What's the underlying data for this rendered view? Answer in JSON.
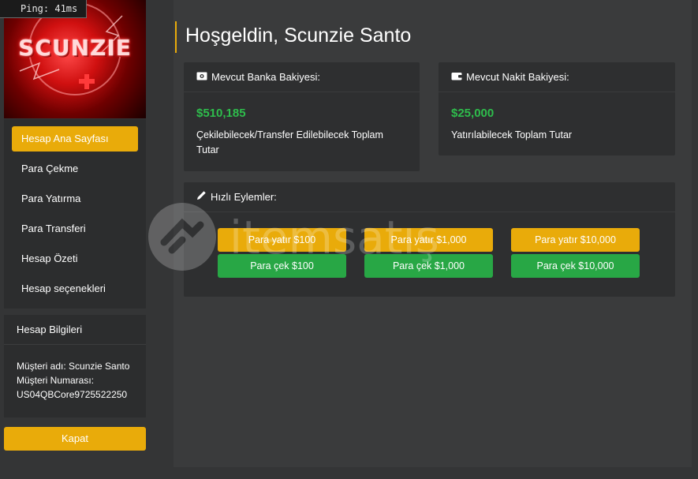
{
  "ping": "Ping: 41ms",
  "logo": {
    "text": "SCUNZIE"
  },
  "sidebar": {
    "items": [
      {
        "label": "Hesap Ana Sayfası",
        "active": true
      },
      {
        "label": "Para Çekme",
        "active": false
      },
      {
        "label": "Para Yatırma",
        "active": false
      },
      {
        "label": "Para Transferi",
        "active": false
      },
      {
        "label": "Hesap Özeti",
        "active": false
      },
      {
        "label": "Hesap seçenekleri",
        "active": false
      }
    ]
  },
  "account_info": {
    "title": "Hesap Bilgileri",
    "customer_name": "Müşteri adı: Scunzie Santo",
    "customer_number_label": "Müşteri Numarası:",
    "customer_number": "US04QBCore9725522250"
  },
  "close_label": "Kapat",
  "main": {
    "title": "Hoşgeldin, Scunzie Santo",
    "bank": {
      "title": "Mevcut Banka Bakiyesi:",
      "amount": "$510,185",
      "desc": "Çekilebilecek/Transfer Edilebilecek Toplam Tutar"
    },
    "cash": {
      "title": "Mevcut Nakit Bakiyesi:",
      "amount": "$25,000",
      "desc": "Yatırılabilecek Toplam Tutar"
    },
    "quick": {
      "title": "Hızlı Eylemler:",
      "deposit": [
        "Para yatır $100",
        "Para yatır $1,000",
        "Para yatır $10,000"
      ],
      "withdraw": [
        "Para çek $100",
        "Para çek $1,000",
        "Para çek $10,000"
      ]
    }
  },
  "watermark": {
    "text": "itemsatış"
  },
  "colors": {
    "accent": "#e9ab0a",
    "success": "#28a745",
    "amount": "#2ebd4c"
  },
  "icons": {
    "bank": "money-bill-icon",
    "cash": "wallet-icon",
    "quick": "pencil-icon"
  }
}
